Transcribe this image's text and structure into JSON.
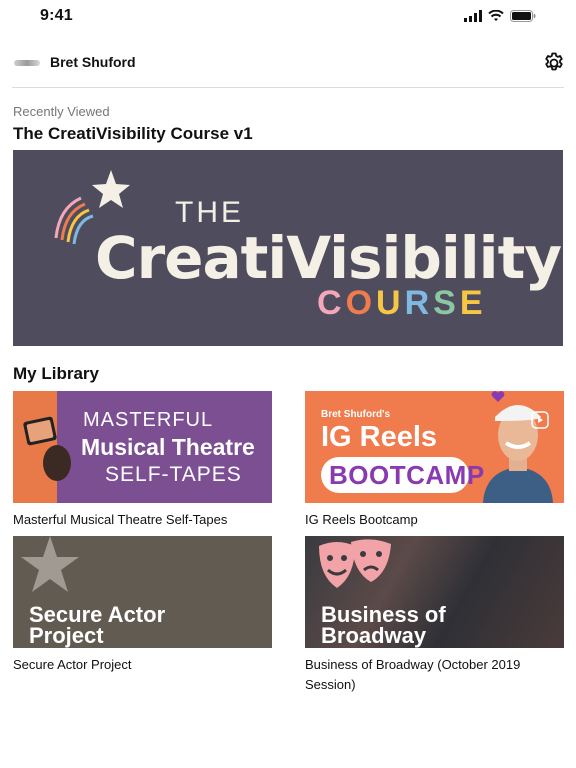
{
  "status_bar": {
    "time": "9:41"
  },
  "header": {
    "user_name": "Bret Shuford"
  },
  "recently_viewed": {
    "section_label": "Recently Viewed",
    "course_title": "The CreatiVisibility Course v1",
    "banner": {
      "line1": "THE",
      "line2": "CreatiVisibility",
      "line3_letters": [
        "C",
        "O",
        "U",
        "R",
        "S",
        "E"
      ],
      "line3_colors": [
        "#f4a7b9",
        "#f07b4d",
        "#f6c644",
        "#7fb8e0",
        "#8cc7a1",
        "#f6c644"
      ]
    }
  },
  "library": {
    "title": "My Library",
    "items": [
      {
        "label": "Masterful Musical Theatre Self-Tapes",
        "thumb_lines": [
          "MASTERFUL",
          "Musical Theatre",
          "SELF-TAPES"
        ]
      },
      {
        "label": "IG Reels Bootcamp",
        "thumb_lines": [
          "Bret Shuford's",
          "IG Reels",
          "BOOTCAMP"
        ]
      },
      {
        "label": "Secure Actor Project",
        "thumb_lines": [
          "Secure Actor",
          "Project"
        ]
      },
      {
        "label": "Business of Broadway (October 2019 Session)",
        "thumb_lines": [
          "Business of",
          "Broadway"
        ]
      }
    ]
  }
}
